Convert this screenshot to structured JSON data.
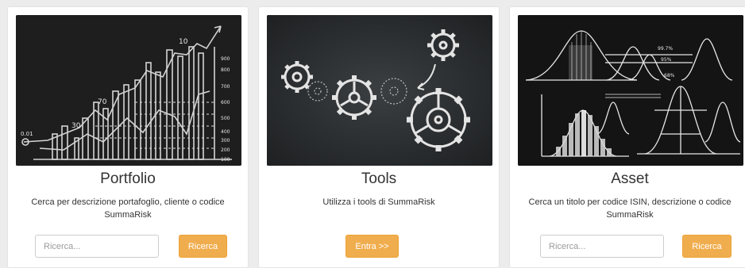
{
  "cards": [
    {
      "title": "Portfolio",
      "description": "Cerca per descrizione portafoglio, cliente o codice SummaRisk",
      "input_placeholder": "Ricerca...",
      "button_label": "Ricerca",
      "image_labels": [
        "10",
        "70",
        "30",
        "0.01",
        "900",
        "800",
        "700",
        "600",
        "500",
        "400",
        "300",
        "200",
        "100"
      ]
    },
    {
      "title": "Tools",
      "description": "Utilizza i tools di SummaRisk",
      "button_label": "Entra >>"
    },
    {
      "title": "Asset",
      "description": "Cerca un titolo per codice ISIN, descrizione o codice SummaRisk",
      "input_placeholder": "Ricerca...",
      "button_label": "Ricerca",
      "image_labels": [
        "99.7%",
        "95%",
        "68%"
      ]
    }
  ],
  "colors": {
    "page_bg": "#ececec",
    "card_bg": "#ffffff",
    "button_bg": "#f0ad4e",
    "chalkboard": "#1c1c1c"
  },
  "icons": [
    "chalk-chart-image",
    "gears-image",
    "bell-curve-image"
  ]
}
